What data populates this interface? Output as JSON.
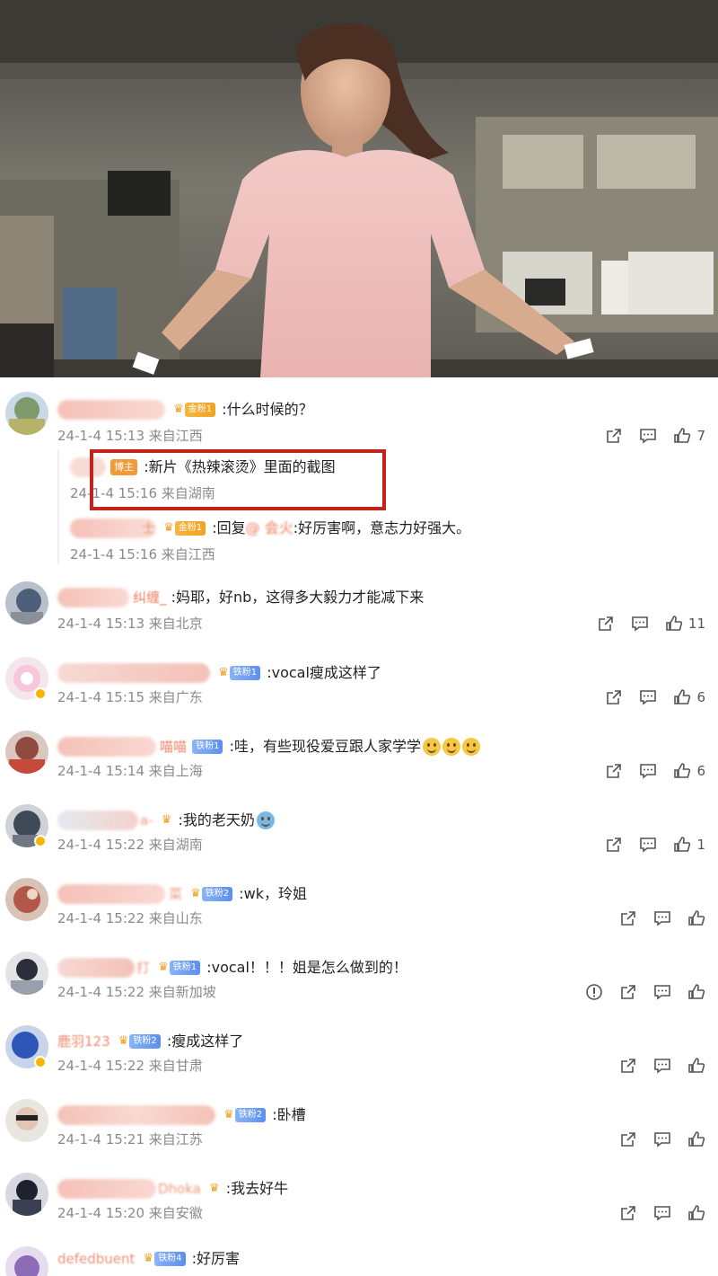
{
  "hero": {
    "alt_icon": "video-still-image"
  },
  "comments": [
    {
      "text": ":什么时候的？",
      "fan_label": "金粉1",
      "fan_style": "gold",
      "time": "24-1-4 15:13",
      "location": "来自江西",
      "likes": "7",
      "replies": [
        {
          "boss_label": "博主",
          "text": ":新片《热辣滚烫》里面的截图",
          "time": "24-1-4 15:16",
          "location": "来自湖南"
        },
        {
          "name_fragment": "士",
          "fan_label": "金粉1",
          "reply_prefix": ":回复",
          "reply_name": "@ 会火",
          "text": ":好厉害啊，意志力好强大。",
          "time": "24-1-4 15:16",
          "location": "来自江西"
        }
      ]
    },
    {
      "name_fragment": "纠缠_",
      "text": ":妈耶，好nb，这得多大毅力才能减下来",
      "time": "24-1-4 15:13",
      "location": "来自北京",
      "likes": "11"
    },
    {
      "fan_label": "铁粉1",
      "fan_style": "blue",
      "text": ":vocal瘦成这样了",
      "time": "24-1-4 15:15",
      "location": "来自广东",
      "likes": "6"
    },
    {
      "name_fragment": "喵喵",
      "fan_label": "铁粉1",
      "fan_style": "blue",
      "text": ":哇，有些现役爱豆跟人家学学",
      "time": "24-1-4 15:14",
      "location": "来自上海",
      "likes": "6"
    },
    {
      "name_fragment": "a-",
      "text": ":我的老天奶",
      "time": "24-1-4 15:22",
      "location": "来自湖南",
      "likes": "1"
    },
    {
      "name_fragment": "菜",
      "fan_label": "铁粉2",
      "fan_style": "blue",
      "text": ":wk，玲姐",
      "time": "24-1-4 15:22",
      "location": "来自山东",
      "likes": ""
    },
    {
      "name_fragment": "打",
      "fan_label": "铁粉1",
      "fan_style": "blue",
      "text": ":vocal！！！姐是怎么做到的！",
      "time": "24-1-4 15:22",
      "location": "来自新加坡",
      "likes": ""
    },
    {
      "name_fragment": "鹿羽123",
      "fan_label": "铁粉2",
      "fan_style": "blue",
      "text": ":瘦成这样了",
      "time": "24-1-4 15:22",
      "location": "来自甘肃",
      "likes": ""
    },
    {
      "fan_label": "铁粉2",
      "fan_style": "blue",
      "text": ":卧槽",
      "time": "24-1-4 15:21",
      "location": "来自江苏",
      "likes": ""
    },
    {
      "name_fragment": "Dhoka",
      "text": ":我去好牛",
      "time": "24-1-4 15:20",
      "location": "来自安徽",
      "likes": ""
    },
    {
      "name_fragment": "defedbuent",
      "fan_label": "铁粉4",
      "fan_style": "blue",
      "text": ":好厉害",
      "time": "",
      "location": "",
      "likes": ""
    }
  ],
  "colors": {
    "highlight": "#c4221b",
    "link": "#eb7350",
    "meta": "#8a8a8a"
  }
}
